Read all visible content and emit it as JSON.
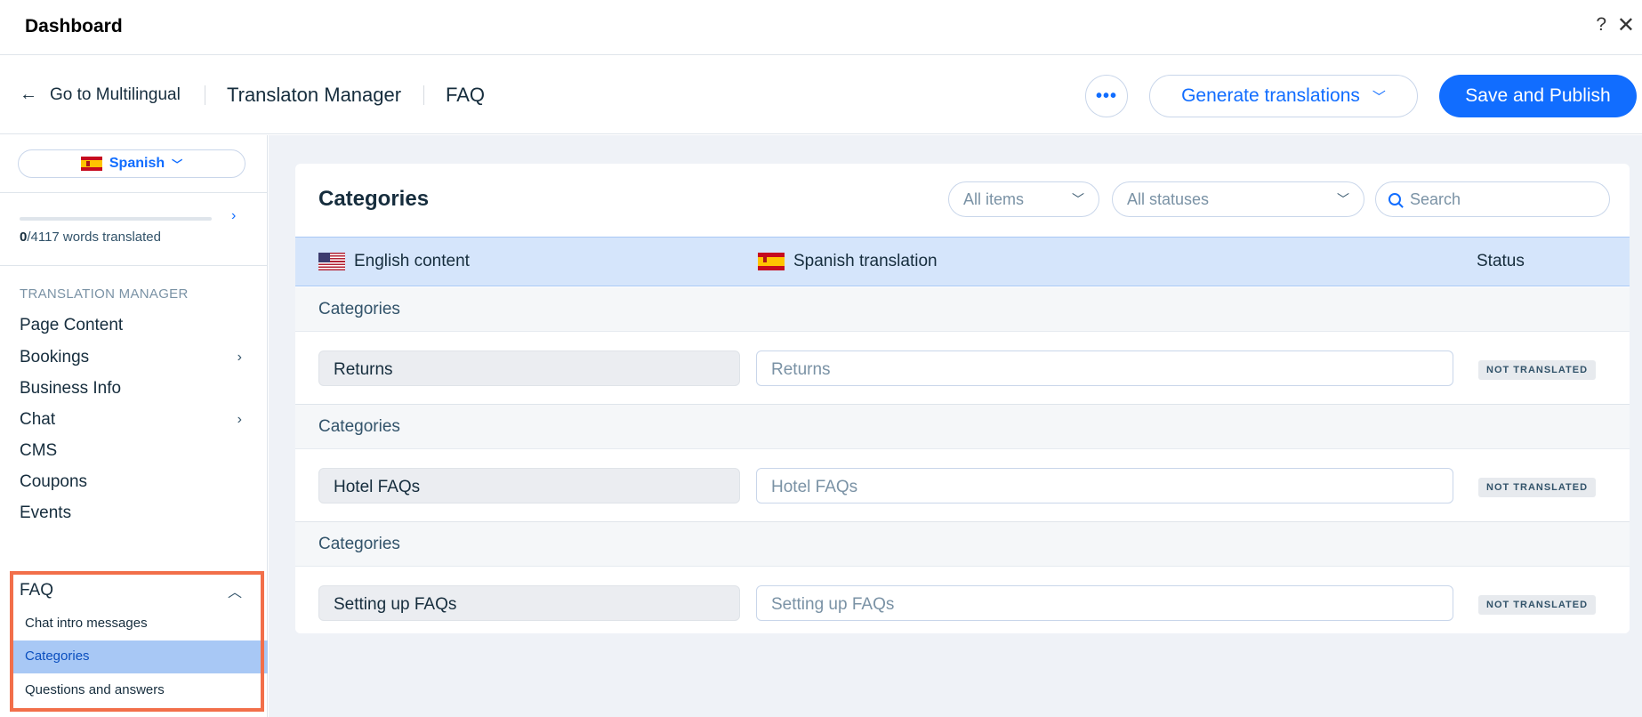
{
  "topbar": {
    "title": "Dashboard",
    "help_icon": "?",
    "close_icon": "✕"
  },
  "header": {
    "back_label": "Go to Multilingual",
    "back_icon": "←",
    "crumb_manager": "Translaton Manager",
    "crumb_faq": "FAQ",
    "more_icon": "•••",
    "generate_label": "Generate translations",
    "save_label": "Save and Publish",
    "accent_color": "#116dff"
  },
  "sidebar": {
    "language": "Spanish",
    "progress": {
      "translated": "0",
      "total_text": "/4117 words translated",
      "fraction": 0
    },
    "section_label": "TRANSLATION MANAGER",
    "items": [
      {
        "label": "Page Content",
        "expandable": false
      },
      {
        "label": "Bookings",
        "expandable": true
      },
      {
        "label": "Business Info",
        "expandable": false
      },
      {
        "label": "Chat",
        "expandable": true
      },
      {
        "label": "CMS",
        "expandable": false
      },
      {
        "label": "Coupons",
        "expandable": false
      },
      {
        "label": "Events",
        "expandable": false
      },
      {
        "label": "FAQ",
        "expandable": true,
        "expanded": true
      }
    ],
    "faq_subitems": [
      "Chat intro messages",
      "Categories",
      "Questions and answers"
    ],
    "active_subitem": "Categories",
    "highlight_color": "#f26f4a"
  },
  "main": {
    "title": "Categories",
    "filters": {
      "items": "All items",
      "statuses": "All statuses"
    },
    "search_placeholder": "Search",
    "columns": {
      "source": "English content",
      "target": "Spanish translation",
      "status": "Status"
    },
    "rows": [
      {
        "group": "Categories",
        "source": "Returns",
        "target_placeholder": "Returns",
        "status": "NOT TRANSLATED"
      },
      {
        "group": "Categories",
        "source": "Hotel FAQs",
        "target_placeholder": "Hotel FAQs",
        "status": "NOT TRANSLATED"
      },
      {
        "group": "Categories",
        "source": "Setting up FAQs",
        "target_placeholder": "Setting up FAQs",
        "status": "NOT TRANSLATED"
      }
    ]
  }
}
